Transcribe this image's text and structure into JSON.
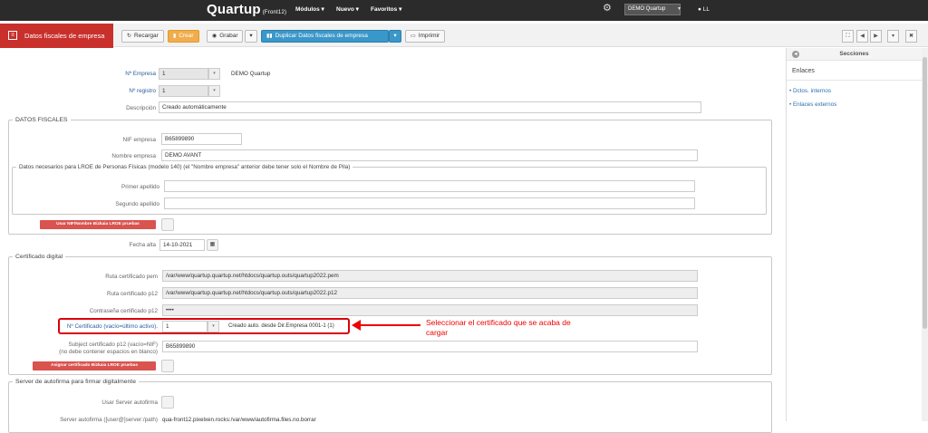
{
  "topbar": {
    "logo": "Quartup",
    "logo_suffix": "(Front12)",
    "nav": [
      "Módulos",
      "Nuevo",
      "Favoritos"
    ],
    "empresa": "DEMO Quartup",
    "user": "LL"
  },
  "page_title": "Datos fiscales de empresa",
  "toolbar": {
    "recargar": "Recargar",
    "crear": "Crear",
    "grabar": "Grabar",
    "duplicar": "Duplicar Datos fiscales de empresa",
    "imprimir": "Imprimir"
  },
  "form": {
    "n_empresa": {
      "label": "Nº Empresa",
      "value": "1",
      "name": "DEMO Quartup"
    },
    "n_registro": {
      "label": "Nº registro",
      "value": "1"
    },
    "descripcion": {
      "label": "Descripción",
      "value": "Creado automáticamente"
    },
    "datos_fiscales": {
      "legend": "DATOS FISCALES",
      "nif_label": "NIF empresa",
      "nif": "B65899890",
      "nombre_label": "Nombre empresa",
      "nombre": "DEMO AVANT",
      "lroe_legend": "Datos necesarios para LROE de Personas Físicas (modelo 140) (el \"Nombre empresa\" anterior debe tener solo el Nombre de Pila)",
      "primer_apellido": "Primer apellido",
      "segundo_apellido": "Segundo apellido",
      "usar_btn": "Usar NIF/Nombre Bizkaia LROE pruebas"
    },
    "fecha_alta": {
      "label": "Fecha alta",
      "value": "14-10-2021"
    },
    "certificado": {
      "legend": "Certificado digital",
      "pem_label": "Ruta certificado pem",
      "pem": "/var/www/quartup.quartup.net/htdocs/quartup.outs/quartup2022.pem",
      "p12_label": "Ruta certificado p12",
      "p12": "/var/www/quartup.quartup.net/htdocs/quartup.outs/quartup2022.p12",
      "pass_label": "Contraseña certificado p12",
      "pass": "••••",
      "ncert_label": "Nº Certificado (vacío=último activo).",
      "ncert": "1",
      "ncert_desc": "Creado auto. desde Dir.Empresa 0001-1 (1)",
      "subject_label1": "Subject certificado p12 (vacío=NIF)",
      "subject_label2": "(no debe contener espacios en blanco)",
      "subject": "B65899890",
      "asignar_btn": "Asignar certificado Bizkaia LROE pruebas"
    },
    "autofirma": {
      "legend": "Server de autofirma para firmar digitalmente",
      "usar_label": "Usar Server autofirma",
      "server_label": "Server autofirma ([user@]server:/path)",
      "server": "qua-front12.pixelxen.rocks:/var/www/autofirma.files.no.borrar"
    }
  },
  "annotation": "Seleccionar el certificado que se acaba de cargar",
  "sidebar": {
    "header": "Secciones",
    "title": "Enlaces",
    "links": [
      "Dctos. internos",
      "Enlaces externos"
    ]
  }
}
